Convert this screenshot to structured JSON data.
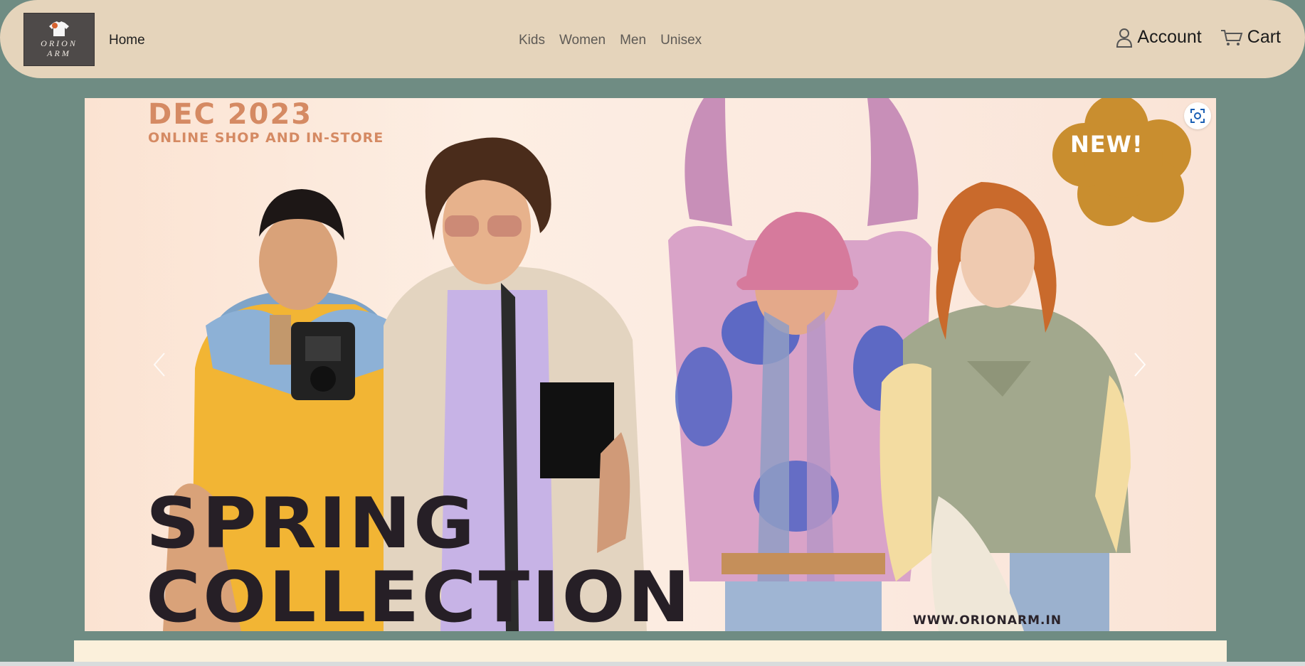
{
  "brand": {
    "logo_text": "ORION\nARM",
    "logo_alt": "ORION ARM"
  },
  "nav": {
    "home": "Home",
    "categories": [
      "Kids",
      "Women",
      "Men",
      "Unisex"
    ],
    "account": "Account",
    "cart": "Cart",
    "account_icon": "person-icon",
    "cart_icon": "cart-icon"
  },
  "hero": {
    "date": "DEC 2023",
    "subtitle": "ONLINE SHOP AND IN-STORE",
    "badge": "NEW!",
    "headline_line1": "SPRING",
    "headline_line2": "COLLECTION",
    "website": "WWW.ORIONARM.IN",
    "prev_icon": "chevron-left-icon",
    "next_icon": "chevron-right-icon",
    "lens_icon": "visual-search-icon"
  },
  "colors": {
    "page_bg": "#6f8c83",
    "navbar_bg": "#e5d4bb",
    "promo_accent": "#d58a63",
    "badge": "#c98e2f",
    "headline": "#261f26"
  }
}
